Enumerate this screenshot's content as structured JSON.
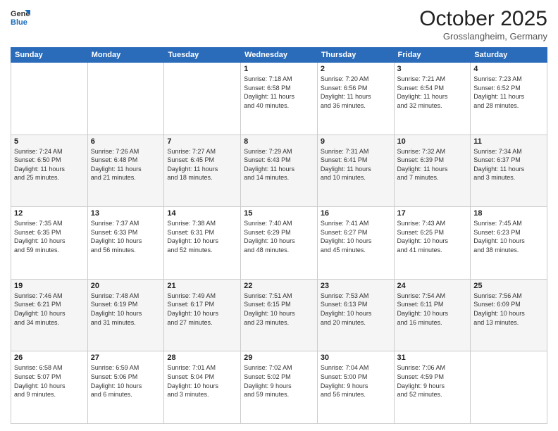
{
  "header": {
    "logo_line1": "General",
    "logo_line2": "Blue",
    "month_title": "October 2025",
    "location": "Grosslangheim, Germany"
  },
  "weekdays": [
    "Sunday",
    "Monday",
    "Tuesday",
    "Wednesday",
    "Thursday",
    "Friday",
    "Saturday"
  ],
  "weeks": [
    [
      {
        "day": "",
        "info": ""
      },
      {
        "day": "",
        "info": ""
      },
      {
        "day": "",
        "info": ""
      },
      {
        "day": "1",
        "info": "Sunrise: 7:18 AM\nSunset: 6:58 PM\nDaylight: 11 hours\nand 40 minutes."
      },
      {
        "day": "2",
        "info": "Sunrise: 7:20 AM\nSunset: 6:56 PM\nDaylight: 11 hours\nand 36 minutes."
      },
      {
        "day": "3",
        "info": "Sunrise: 7:21 AM\nSunset: 6:54 PM\nDaylight: 11 hours\nand 32 minutes."
      },
      {
        "day": "4",
        "info": "Sunrise: 7:23 AM\nSunset: 6:52 PM\nDaylight: 11 hours\nand 28 minutes."
      }
    ],
    [
      {
        "day": "5",
        "info": "Sunrise: 7:24 AM\nSunset: 6:50 PM\nDaylight: 11 hours\nand 25 minutes."
      },
      {
        "day": "6",
        "info": "Sunrise: 7:26 AM\nSunset: 6:48 PM\nDaylight: 11 hours\nand 21 minutes."
      },
      {
        "day": "7",
        "info": "Sunrise: 7:27 AM\nSunset: 6:45 PM\nDaylight: 11 hours\nand 18 minutes."
      },
      {
        "day": "8",
        "info": "Sunrise: 7:29 AM\nSunset: 6:43 PM\nDaylight: 11 hours\nand 14 minutes."
      },
      {
        "day": "9",
        "info": "Sunrise: 7:31 AM\nSunset: 6:41 PM\nDaylight: 11 hours\nand 10 minutes."
      },
      {
        "day": "10",
        "info": "Sunrise: 7:32 AM\nSunset: 6:39 PM\nDaylight: 11 hours\nand 7 minutes."
      },
      {
        "day": "11",
        "info": "Sunrise: 7:34 AM\nSunset: 6:37 PM\nDaylight: 11 hours\nand 3 minutes."
      }
    ],
    [
      {
        "day": "12",
        "info": "Sunrise: 7:35 AM\nSunset: 6:35 PM\nDaylight: 10 hours\nand 59 minutes."
      },
      {
        "day": "13",
        "info": "Sunrise: 7:37 AM\nSunset: 6:33 PM\nDaylight: 10 hours\nand 56 minutes."
      },
      {
        "day": "14",
        "info": "Sunrise: 7:38 AM\nSunset: 6:31 PM\nDaylight: 10 hours\nand 52 minutes."
      },
      {
        "day": "15",
        "info": "Sunrise: 7:40 AM\nSunset: 6:29 PM\nDaylight: 10 hours\nand 48 minutes."
      },
      {
        "day": "16",
        "info": "Sunrise: 7:41 AM\nSunset: 6:27 PM\nDaylight: 10 hours\nand 45 minutes."
      },
      {
        "day": "17",
        "info": "Sunrise: 7:43 AM\nSunset: 6:25 PM\nDaylight: 10 hours\nand 41 minutes."
      },
      {
        "day": "18",
        "info": "Sunrise: 7:45 AM\nSunset: 6:23 PM\nDaylight: 10 hours\nand 38 minutes."
      }
    ],
    [
      {
        "day": "19",
        "info": "Sunrise: 7:46 AM\nSunset: 6:21 PM\nDaylight: 10 hours\nand 34 minutes."
      },
      {
        "day": "20",
        "info": "Sunrise: 7:48 AM\nSunset: 6:19 PM\nDaylight: 10 hours\nand 31 minutes."
      },
      {
        "day": "21",
        "info": "Sunrise: 7:49 AM\nSunset: 6:17 PM\nDaylight: 10 hours\nand 27 minutes."
      },
      {
        "day": "22",
        "info": "Sunrise: 7:51 AM\nSunset: 6:15 PM\nDaylight: 10 hours\nand 23 minutes."
      },
      {
        "day": "23",
        "info": "Sunrise: 7:53 AM\nSunset: 6:13 PM\nDaylight: 10 hours\nand 20 minutes."
      },
      {
        "day": "24",
        "info": "Sunrise: 7:54 AM\nSunset: 6:11 PM\nDaylight: 10 hours\nand 16 minutes."
      },
      {
        "day": "25",
        "info": "Sunrise: 7:56 AM\nSunset: 6:09 PM\nDaylight: 10 hours\nand 13 minutes."
      }
    ],
    [
      {
        "day": "26",
        "info": "Sunrise: 6:58 AM\nSunset: 5:07 PM\nDaylight: 10 hours\nand 9 minutes."
      },
      {
        "day": "27",
        "info": "Sunrise: 6:59 AM\nSunset: 5:06 PM\nDaylight: 10 hours\nand 6 minutes."
      },
      {
        "day": "28",
        "info": "Sunrise: 7:01 AM\nSunset: 5:04 PM\nDaylight: 10 hours\nand 3 minutes."
      },
      {
        "day": "29",
        "info": "Sunrise: 7:02 AM\nSunset: 5:02 PM\nDaylight: 9 hours\nand 59 minutes."
      },
      {
        "day": "30",
        "info": "Sunrise: 7:04 AM\nSunset: 5:00 PM\nDaylight: 9 hours\nand 56 minutes."
      },
      {
        "day": "31",
        "info": "Sunrise: 7:06 AM\nSunset: 4:59 PM\nDaylight: 9 hours\nand 52 minutes."
      },
      {
        "day": "",
        "info": ""
      }
    ]
  ]
}
